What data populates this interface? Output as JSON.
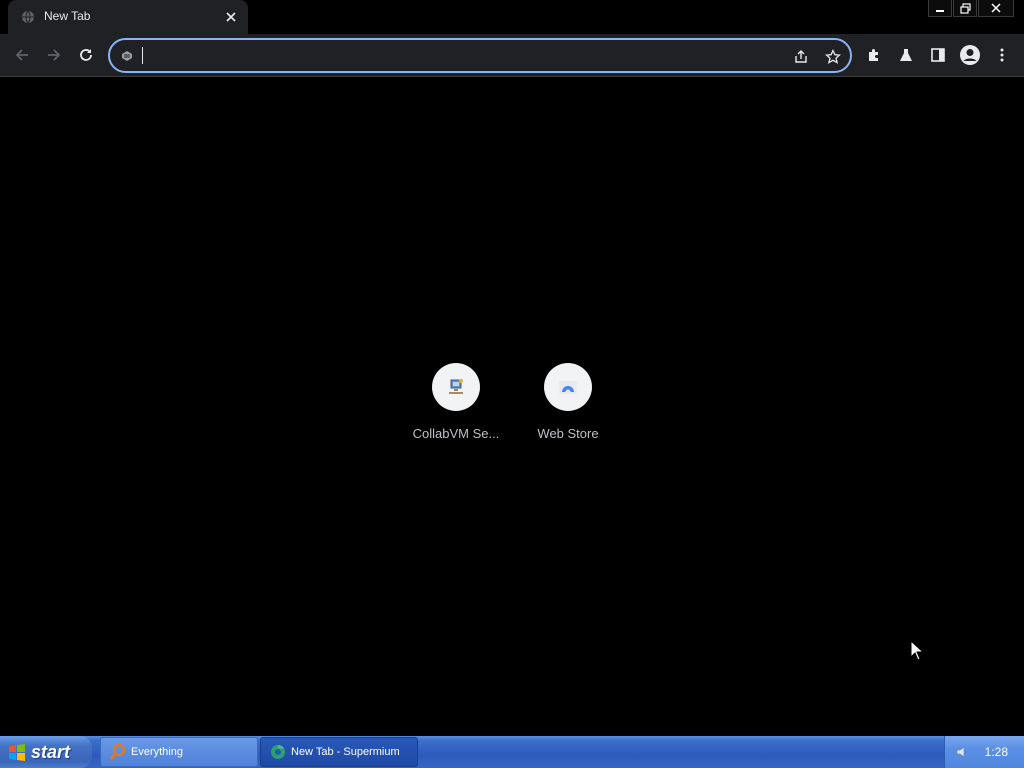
{
  "browser": {
    "tab": {
      "title": "New Tab"
    },
    "omnibox": {
      "value": "",
      "placeholder": ""
    },
    "shortcuts": [
      {
        "label": "CollabVM Se..."
      },
      {
        "label": "Web Store"
      }
    ]
  },
  "taskbar": {
    "start_label": "start",
    "tasks": [
      {
        "label": "Everything"
      },
      {
        "label": "New Tab - Supermium"
      }
    ],
    "clock": "1:28"
  },
  "colors": {
    "accent": "#8ab4f8",
    "toolbar": "#202124",
    "page_bg": "#000000",
    "taskbar": "#3465c4"
  }
}
